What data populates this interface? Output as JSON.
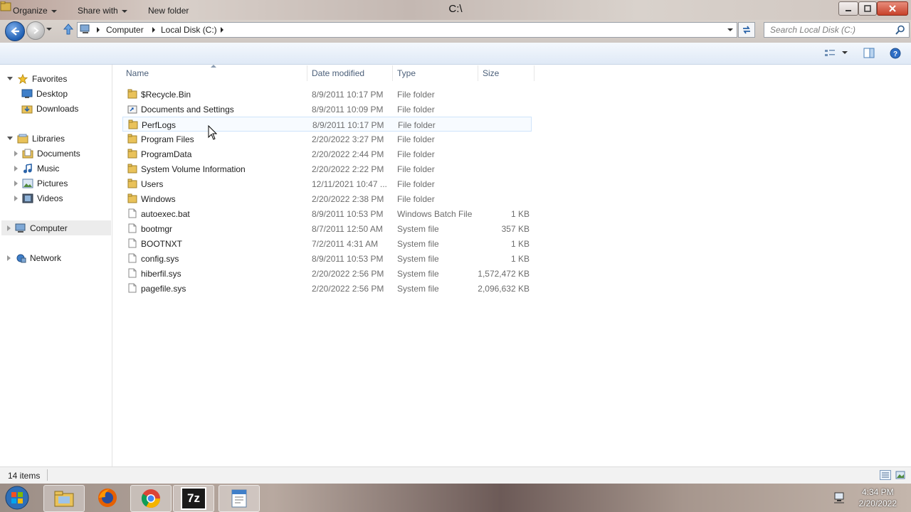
{
  "window": {
    "title": "C:\\",
    "controls": [
      "minimize-icon",
      "maximize-icon",
      "close-icon"
    ]
  },
  "address": {
    "breadcrumb": [
      "Computer",
      "Local Disk (C:)"
    ],
    "search_placeholder": "Search Local Disk (C:)"
  },
  "toolbar": {
    "organize": "Organize",
    "share_with": "Share with",
    "new_folder": "New folder"
  },
  "nav": {
    "favorites": "Favorites",
    "desktop": "Desktop",
    "downloads": "Downloads",
    "libraries": "Libraries",
    "documents": "Documents",
    "music": "Music",
    "pictures": "Pictures",
    "videos": "Videos",
    "computer": "Computer",
    "network": "Network"
  },
  "columns": {
    "name": "Name",
    "date": "Date modified",
    "type": "Type",
    "size": "Size"
  },
  "files": [
    {
      "name": "$Recycle.Bin",
      "date": "8/9/2011 10:17 PM",
      "type": "File folder",
      "size": "",
      "icon": "folder-icon"
    },
    {
      "name": "Documents and Settings",
      "date": "8/9/2011 10:09 PM",
      "type": "File folder",
      "size": "",
      "icon": "shortcut-folder-icon"
    },
    {
      "name": "PerfLogs",
      "date": "8/9/2011 10:17 PM",
      "type": "File folder",
      "size": "",
      "icon": "folder-icon"
    },
    {
      "name": "Program Files",
      "date": "2/20/2022 3:27 PM",
      "type": "File folder",
      "size": "",
      "icon": "folder-icon"
    },
    {
      "name": "ProgramData",
      "date": "2/20/2022 2:44 PM",
      "type": "File folder",
      "size": "",
      "icon": "folder-icon"
    },
    {
      "name": "System Volume Information",
      "date": "2/20/2022 2:22 PM",
      "type": "File folder",
      "size": "",
      "icon": "folder-icon"
    },
    {
      "name": "Users",
      "date": "12/11/2021 10:47 ...",
      "type": "File folder",
      "size": "",
      "icon": "folder-icon"
    },
    {
      "name": "Windows",
      "date": "2/20/2022 2:38 PM",
      "type": "File folder",
      "size": "",
      "icon": "folder-icon"
    },
    {
      "name": "autoexec.bat",
      "date": "8/9/2011 10:53 PM",
      "type": "Windows Batch File",
      "size": "1 KB",
      "icon": "file-icon"
    },
    {
      "name": "bootmgr",
      "date": "8/7/2011 12:50 AM",
      "type": "System file",
      "size": "357 KB",
      "icon": "file-icon"
    },
    {
      "name": "BOOTNXT",
      "date": "7/2/2011 4:31 AM",
      "type": "System file",
      "size": "1 KB",
      "icon": "file-icon"
    },
    {
      "name": "config.sys",
      "date": "8/9/2011 10:53 PM",
      "type": "System file",
      "size": "1 KB",
      "icon": "file-icon"
    },
    {
      "name": "hiberfil.sys",
      "date": "2/20/2022 2:56 PM",
      "type": "System file",
      "size": "1,572,472 KB",
      "icon": "file-icon"
    },
    {
      "name": "pagefile.sys",
      "date": "2/20/2022 2:56 PM",
      "type": "System file",
      "size": "2,096,632 KB",
      "icon": "file-icon"
    }
  ],
  "status": {
    "item_count": "14 items"
  },
  "taskbar": {
    "apps": [
      "start-orb-icon",
      "file-explorer-icon",
      "firefox-icon",
      "chrome-icon",
      "7zip-icon",
      "wordpad-icon"
    ],
    "zip_label": "7z",
    "time": "4:34 PM",
    "date": "2/20/2022"
  },
  "colors": {
    "accent": "#1f5fb3",
    "folder": "#e9c25a",
    "header_text": "#4c607a"
  }
}
